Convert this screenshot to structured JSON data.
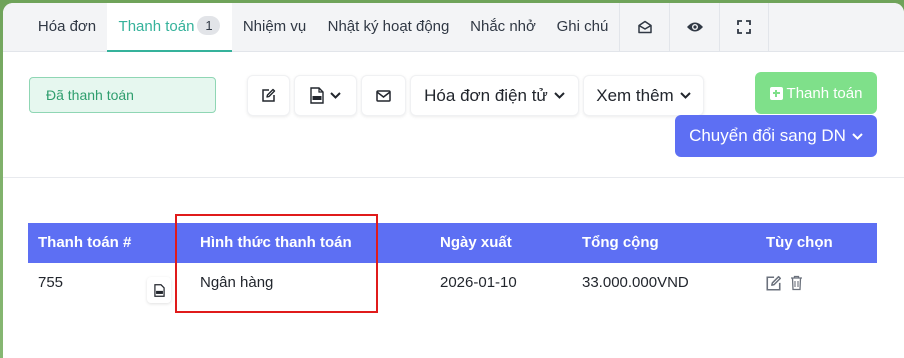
{
  "tabs": [
    {
      "label": "Hóa đơn"
    },
    {
      "label": "Thanh toán",
      "count": "1",
      "active": true
    },
    {
      "label": "Nhiệm vụ"
    },
    {
      "label": "Nhật ký hoạt động"
    },
    {
      "label": "Nhắc nhở"
    },
    {
      "label": "Ghi chú"
    }
  ],
  "icon_tabs": [
    "envelope-open-icon",
    "eye-icon",
    "fullscreen-icon"
  ],
  "status": {
    "label": "Đã thanh toán"
  },
  "toolbar": {
    "edit_icon": "edit-icon",
    "pdf_icon": "pdf-icon",
    "mail_icon": "envelope-icon",
    "einvoice_label": "Hóa đơn điện tử",
    "more_label": "Xem thêm"
  },
  "actions": {
    "pay_label": "Thanh toán",
    "convert_label": "Chuyển đổi sang DN"
  },
  "table": {
    "headers": [
      "Thanh toán #",
      "Hình thức thanh toán",
      "Ngày xuất",
      "Tổng cộng",
      "Tùy chọn"
    ],
    "rows": [
      {
        "id": "755",
        "method": "Ngân hàng",
        "date": "2026-01-10",
        "total": "33.000.000VND"
      }
    ]
  },
  "colors": {
    "accent": "#35b29b",
    "primary": "#5d6ff3",
    "success": "#7fe08a",
    "highlight_box": "#e01b1b"
  }
}
